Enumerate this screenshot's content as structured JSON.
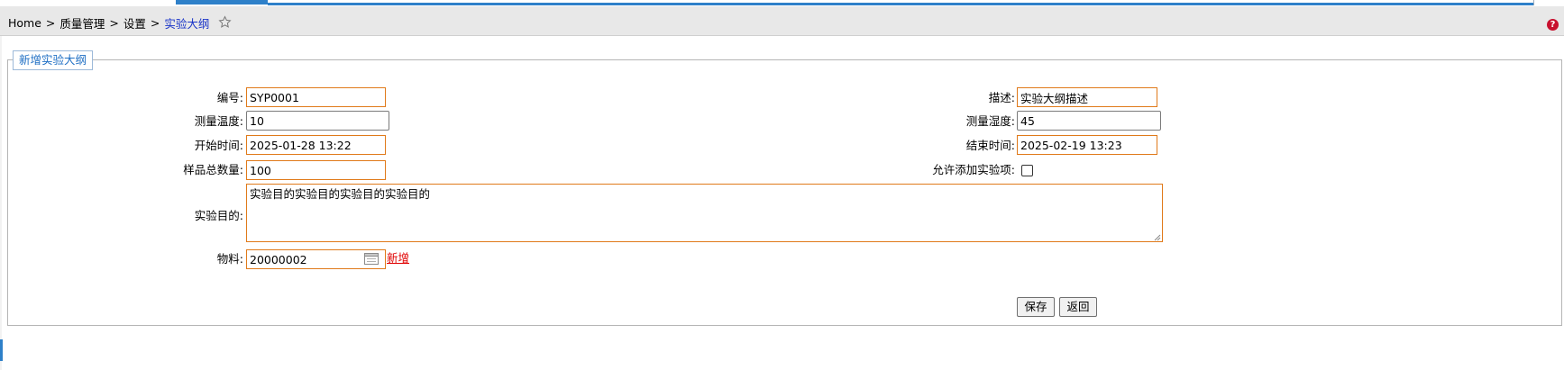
{
  "breadcrumb": {
    "home": "Home",
    "sep": ">",
    "level1": "质量管理",
    "level2": "设置",
    "current": "实验大纲"
  },
  "help_icon_label": "?",
  "form": {
    "legend": "新增实验大纲",
    "fields": {
      "code": {
        "label": "编号:",
        "value": "SYP0001"
      },
      "description": {
        "label": "描述:",
        "value": "实验大纲描述"
      },
      "measure_temp": {
        "label": "测量温度:",
        "value": "10"
      },
      "measure_humidity": {
        "label": "测量湿度:",
        "value": "45"
      },
      "start_time": {
        "label": "开始时间:",
        "value": "2025-01-28 13:22"
      },
      "end_time": {
        "label": "结束时间:",
        "value": "2025-02-19 13:23"
      },
      "sample_total": {
        "label": "样品总数量:",
        "value": "100"
      },
      "allow_add_items": {
        "label": "允许添加实验项:",
        "checked": false
      },
      "purpose": {
        "label": "实验目的:",
        "value": "实验目的实验目的实验目的实验目的"
      },
      "material": {
        "label": "物料:",
        "value": "20000002",
        "add_link": "新增"
      }
    },
    "buttons": {
      "save": "保存",
      "back": "返回"
    }
  },
  "colors": {
    "accent_blue": "#2e80c9",
    "required_border": "#e07a1a",
    "link_red": "#e00000",
    "breadcrumb_current": "#1a35c8"
  }
}
